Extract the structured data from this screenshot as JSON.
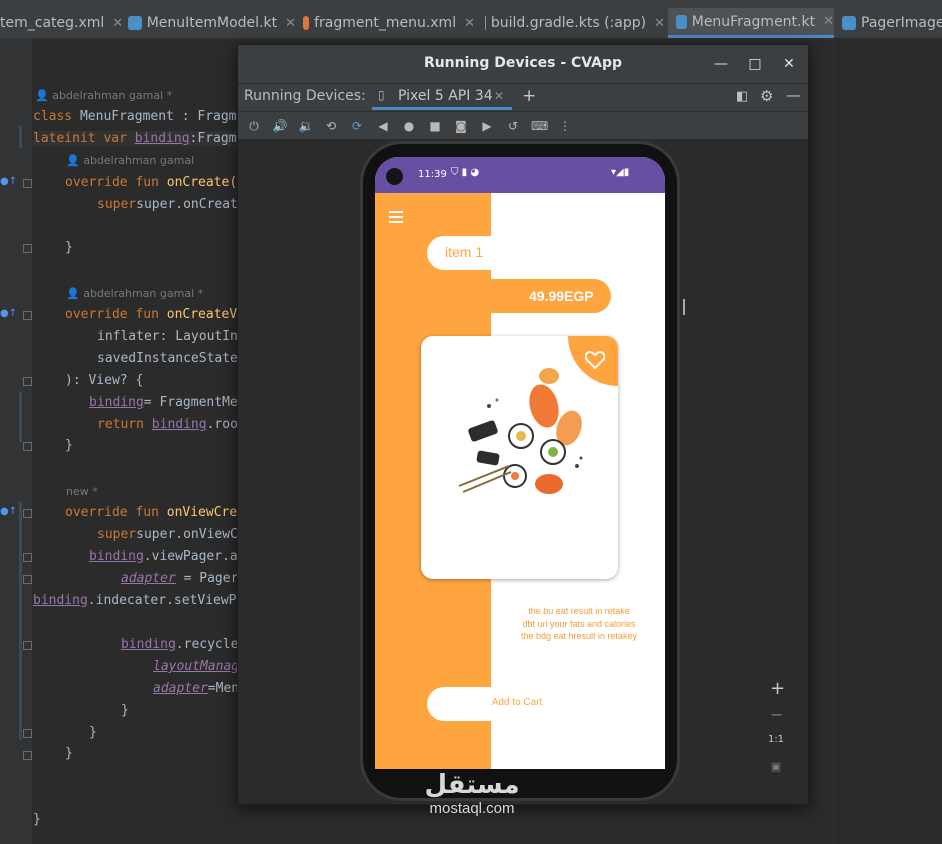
{
  "tabs": [
    {
      "label": "tem_categ.xml",
      "icon": "xml-file-icon",
      "color": "#e8a54a"
    },
    {
      "label": "MenuItemModel.kt",
      "icon": "kotlin-class-icon",
      "color": "#4a90c8"
    },
    {
      "label": "fragment_menu.xml",
      "icon": "layout-file-icon",
      "color": "#e0763a"
    },
    {
      "label": "build.gradle.kts (:app)",
      "icon": "gradle-icon",
      "color": "#7a9cb4"
    },
    {
      "label": "MenuFragment.kt",
      "icon": "kotlin-class-icon",
      "color": "#4a90c8"
    },
    {
      "label": "PagerImage",
      "icon": "kotlin-class-icon",
      "color": "#4a90c8"
    }
  ],
  "editor": {
    "authors": {
      "a1": "abdelrahman gamal *",
      "a2": "abdelrahman gamal",
      "a3": "abdelrahman gamal *",
      "a4": "new *"
    },
    "code": {
      "l1_kw": "class",
      "l1_rest": " MenuFragment : Fragm",
      "l2_kw": "lateinit var",
      "l2_var": "binding",
      "l2_rest": ":Fragm",
      "l3_kw": "override fun",
      "l3_fn": "onCreate(",
      "l4": "super.onCreate(sav",
      "l5": "}",
      "l6_kw": "override fun",
      "l6_fn": "onCreateV",
      "l7": "inflater: LayoutIn",
      "l8": "savedInstanceState",
      "l9": "): View? {",
      "l10_var": "binding",
      "l10_rest": "= FragmentMe",
      "l11_kw": "return",
      "l11_var": "binding",
      "l11_rest": ".roo",
      "l12": "}",
      "l13_kw": "override fun",
      "l13_fn": "onViewCre",
      "l14": "super.onViewCreate",
      "l15_var": "binding",
      "l15_rest": ".viewPager.a",
      "l16_it": "adapter",
      "l16_rest": " = Pager",
      "l17_var": "binding",
      "l17_rest": ".indecater.setViewP",
      "l18_var": "binding",
      "l18_rest": ".recycle",
      "l19_it": "layoutManag",
      "l20_it": "adapter",
      "l20_rest": "=Men",
      "l21": "}",
      "l22": "}",
      "l23": "}",
      "l24": "}"
    }
  },
  "running_devices": {
    "window_title": "Running Devices - CVApp",
    "panel_label": "Running Devices:",
    "device_tab": "Pixel 5 API 34",
    "add_label": "+"
  },
  "phone": {
    "status_time": "11:39",
    "item_name": "item 1",
    "price": "49.99EGP",
    "description": [
      "the bu eat result in retake",
      "dbt uri your fats and calories",
      "the bdg eat hresult in retakey"
    ],
    "add_to_cart": "Add to Cart",
    "accent_color": "#ffa540",
    "status_bar_color": "#6750a4"
  },
  "zoom": {
    "zoom_in": "+",
    "zoom_out": "−",
    "one_to_one": "1:1"
  },
  "watermark": {
    "arabic": "مستقل",
    "latin": "mostaql.com"
  }
}
